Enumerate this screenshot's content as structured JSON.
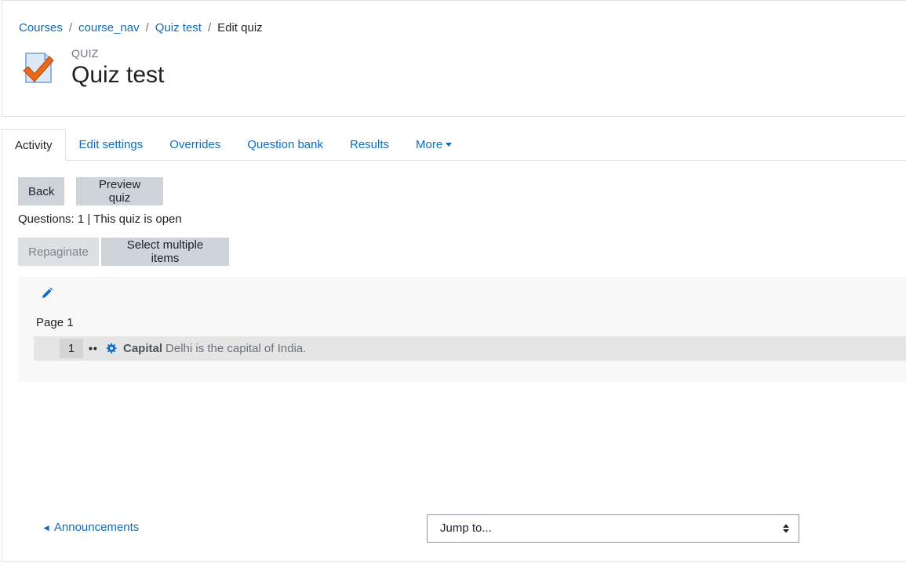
{
  "breadcrumb": {
    "items": [
      "Courses",
      "course_nav",
      "Quiz test"
    ],
    "current": "Edit quiz",
    "separator": "/"
  },
  "header": {
    "pretitle": "QUIZ",
    "title": "Quiz test",
    "icon": "quiz-checkmark-icon"
  },
  "nav": {
    "tabs": [
      "Activity",
      "Edit settings",
      "Overrides",
      "Question bank",
      "Results",
      "More"
    ],
    "active": "Activity"
  },
  "actions": {
    "back": "Back",
    "preview": "Preview quiz"
  },
  "status": "Questions: 1 | This quiz is open",
  "edit_tools": {
    "repaginate": "Repaginate",
    "select_multiple": "Select multiple items"
  },
  "page": {
    "label": "Page 1",
    "slots": [
      {
        "number": "1",
        "dots": "••",
        "name": "Capital",
        "text": "Delhi is the capital of India."
      }
    ]
  },
  "footer": {
    "prev_arrow": "◄",
    "prev_label": "Announcements",
    "jump_placeholder": "Jump to..."
  },
  "colors": {
    "link": "#0f6cbf",
    "button": "#ced4da",
    "text": "#1d2125",
    "muted": "#6a737b"
  }
}
